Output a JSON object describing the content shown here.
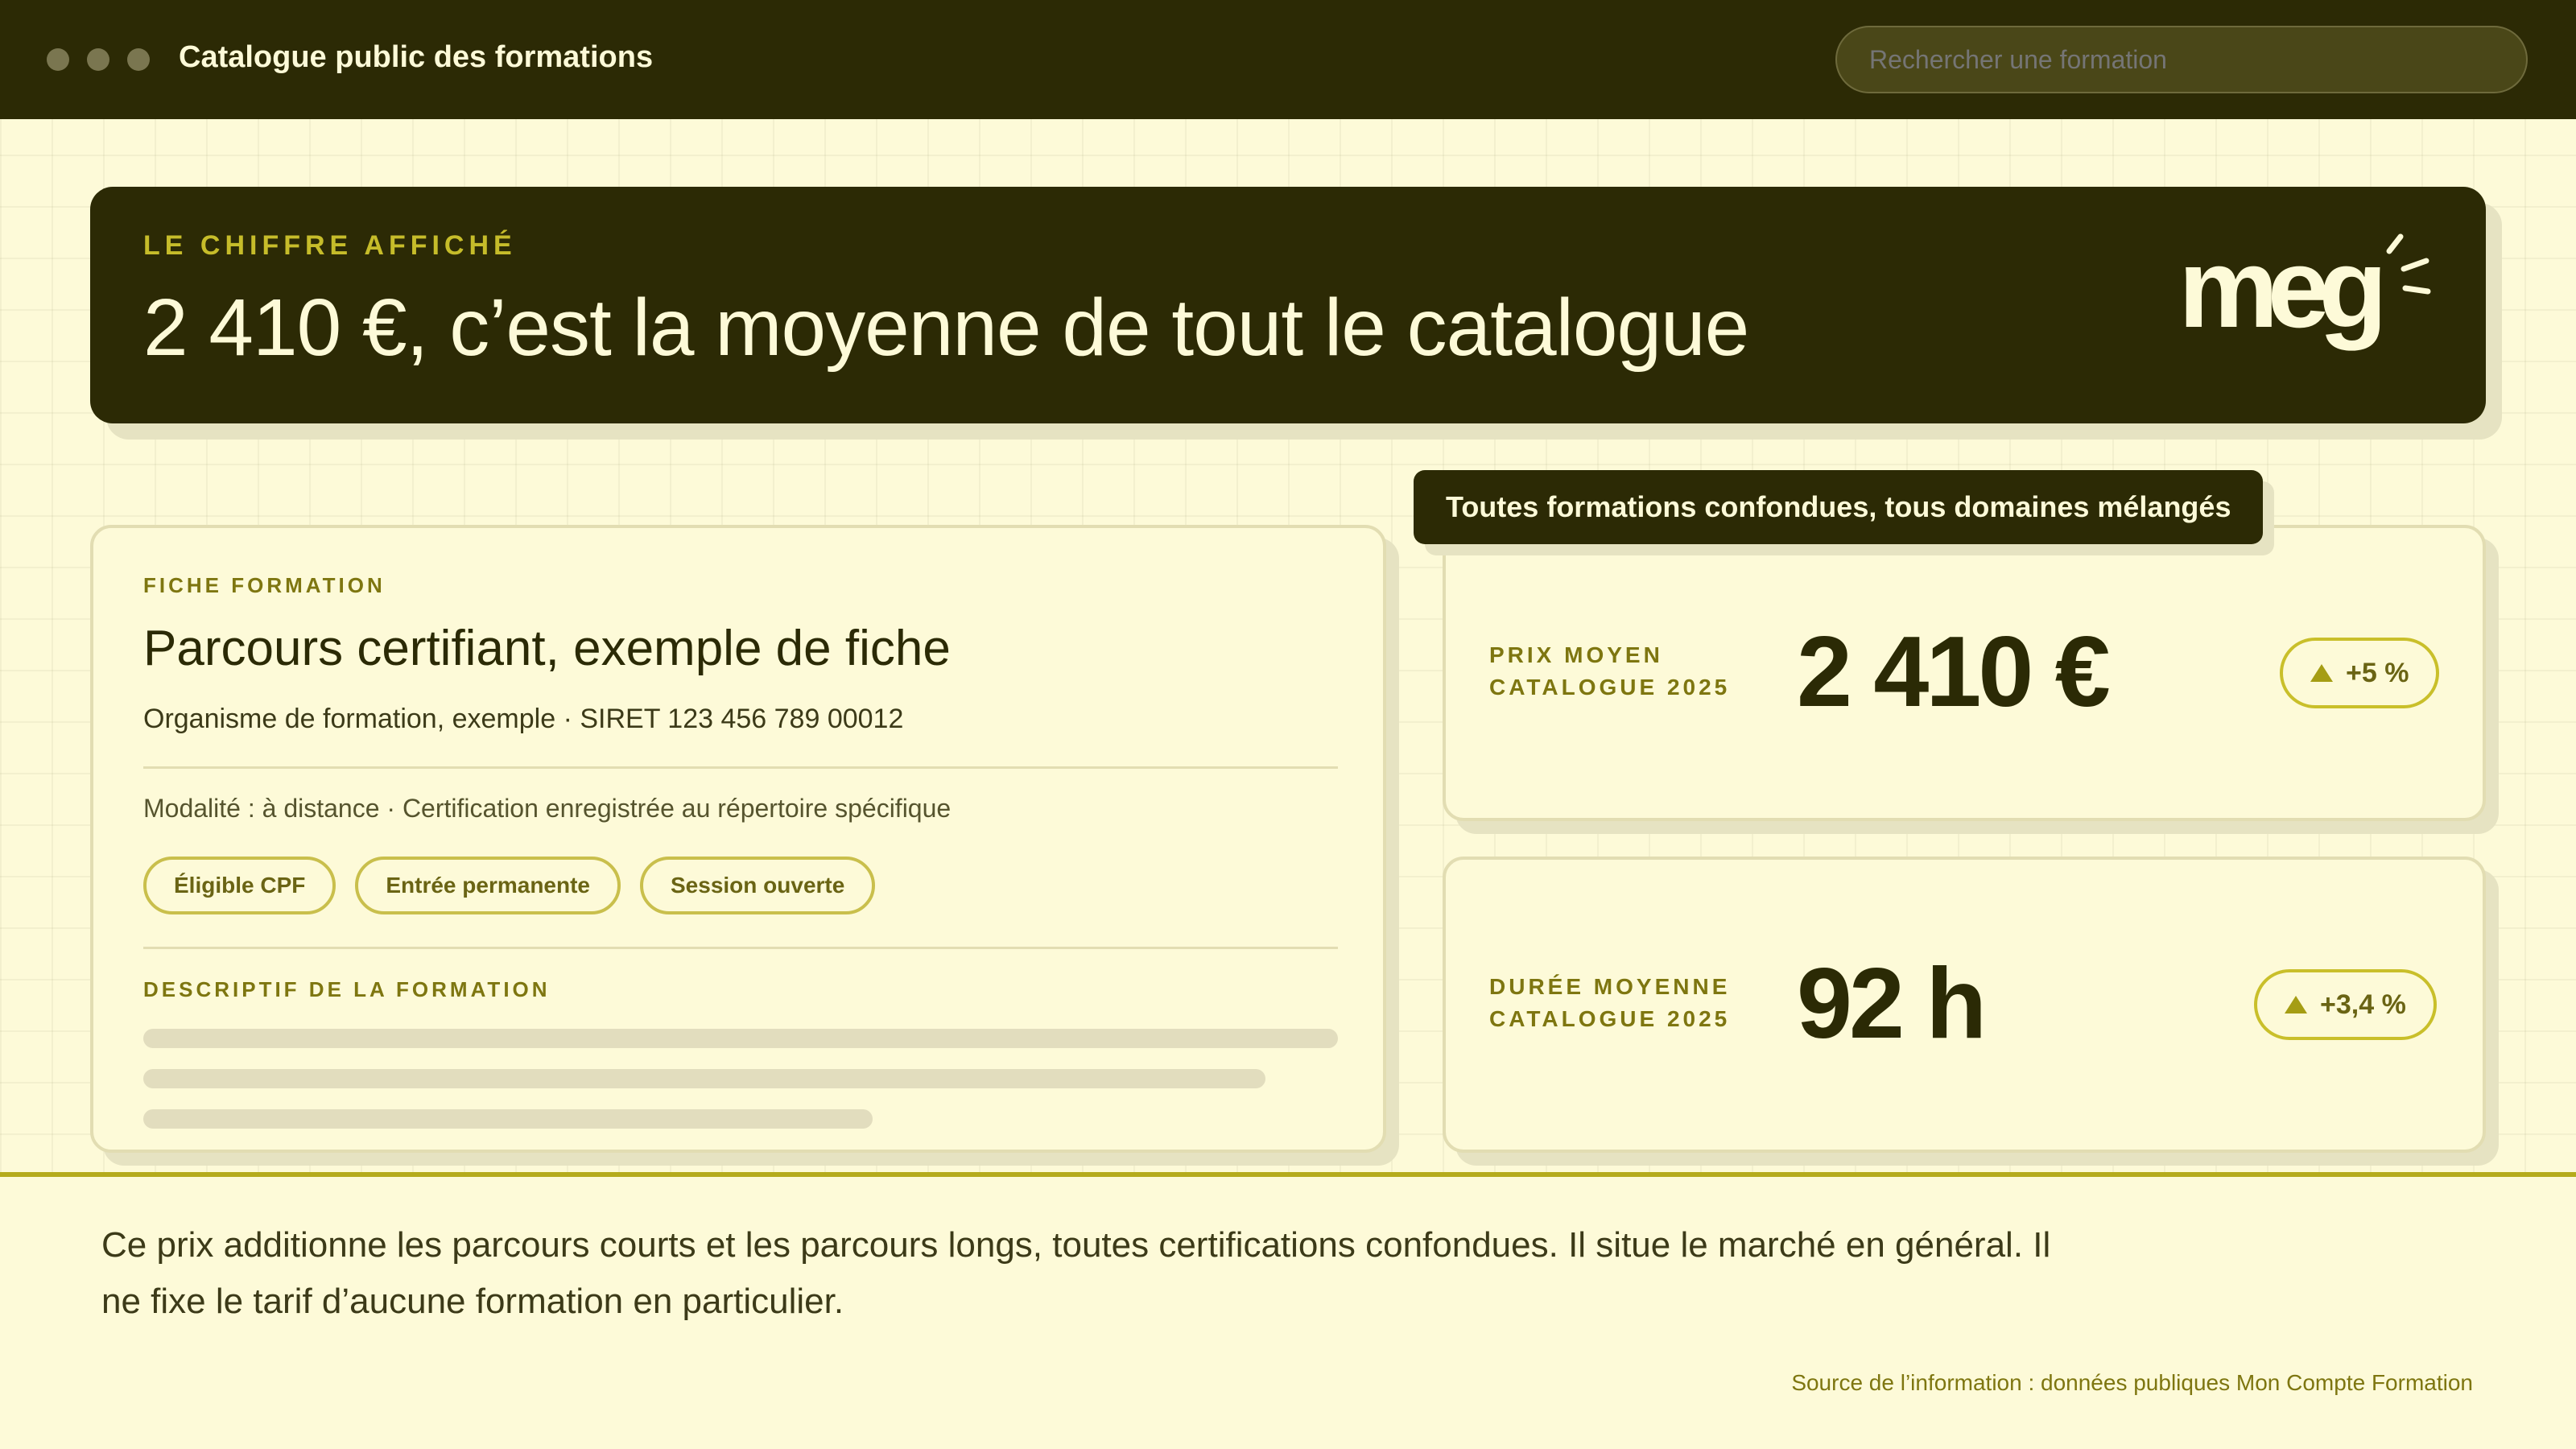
{
  "app": {
    "title": "Catalogue public des formations"
  },
  "search": {
    "placeholder": "Rechercher une formation"
  },
  "hero": {
    "kicker": "LE CHIFFRE AFFICHÉ",
    "title": "2 410 €, c’est la moyenne de tout le catalogue",
    "logo_text": "meg"
  },
  "fiche": {
    "kicker": "FICHE FORMATION",
    "title": "Parcours certifiant, exemple de fiche",
    "organisme": "Organisme de formation, exemple · SIRET 123 456 789 00012",
    "modalite": "Modalité : à distance · Certification enregistrée au répertoire spécifique",
    "tags": [
      "Éligible CPF",
      "Entrée permanente",
      "Session ouverte"
    ],
    "description_kicker": "DESCRIPTIF DE LA FORMATION"
  },
  "stats": {
    "chip": "Toutes formations confondues, tous domaines mélangés",
    "items": [
      {
        "label_line1": "PRIX MOYEN",
        "label_line2": "CATALOGUE 2025",
        "value": "2 410 €",
        "delta": "+5 %"
      },
      {
        "label_line1": "DURÉE MOYENNE",
        "label_line2": "CATALOGUE 2025",
        "value": "92 h",
        "delta": "+3,4 %"
      }
    ]
  },
  "footer": {
    "note": "Ce prix additionne les parcours courts et les parcours longs, toutes certifications confondues. Il situe le marché en général. Il ne fixe le tarif d’aucune formation en particulier.",
    "source": "Source de l’information : données publiques Mon Compte Formation"
  },
  "colors": {
    "dark": "#2c2a05",
    "cream": "#fdfad8",
    "accent": "#c6bc2a",
    "olive_text": "#7e7610"
  }
}
